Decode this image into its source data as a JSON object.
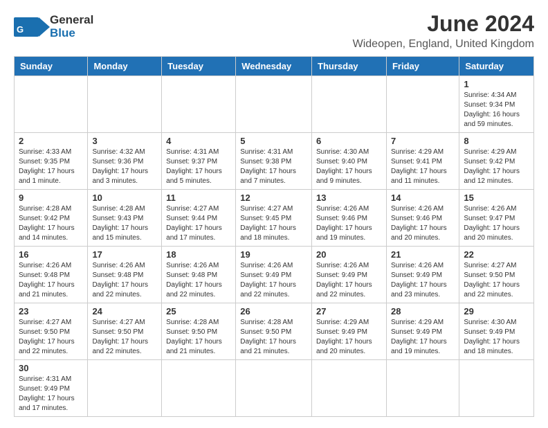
{
  "header": {
    "logo_general": "General",
    "logo_blue": "Blue",
    "month_title": "June 2024",
    "location": "Wideopen, England, United Kingdom"
  },
  "calendar": {
    "days_of_week": [
      "Sunday",
      "Monday",
      "Tuesday",
      "Wednesday",
      "Thursday",
      "Friday",
      "Saturday"
    ],
    "weeks": [
      [
        {
          "day": "",
          "info": ""
        },
        {
          "day": "",
          "info": ""
        },
        {
          "day": "",
          "info": ""
        },
        {
          "day": "",
          "info": ""
        },
        {
          "day": "",
          "info": ""
        },
        {
          "day": "",
          "info": ""
        },
        {
          "day": "1",
          "info": "Sunrise: 4:34 AM\nSunset: 9:34 PM\nDaylight: 16 hours and 59 minutes."
        }
      ],
      [
        {
          "day": "2",
          "info": "Sunrise: 4:33 AM\nSunset: 9:35 PM\nDaylight: 17 hours and 1 minute."
        },
        {
          "day": "3",
          "info": "Sunrise: 4:32 AM\nSunset: 9:36 PM\nDaylight: 17 hours and 3 minutes."
        },
        {
          "day": "4",
          "info": "Sunrise: 4:31 AM\nSunset: 9:37 PM\nDaylight: 17 hours and 5 minutes."
        },
        {
          "day": "5",
          "info": "Sunrise: 4:31 AM\nSunset: 9:38 PM\nDaylight: 17 hours and 7 minutes."
        },
        {
          "day": "6",
          "info": "Sunrise: 4:30 AM\nSunset: 9:40 PM\nDaylight: 17 hours and 9 minutes."
        },
        {
          "day": "7",
          "info": "Sunrise: 4:29 AM\nSunset: 9:41 PM\nDaylight: 17 hours and 11 minutes."
        },
        {
          "day": "8",
          "info": "Sunrise: 4:29 AM\nSunset: 9:42 PM\nDaylight: 17 hours and 12 minutes."
        }
      ],
      [
        {
          "day": "9",
          "info": "Sunrise: 4:28 AM\nSunset: 9:42 PM\nDaylight: 17 hours and 14 minutes."
        },
        {
          "day": "10",
          "info": "Sunrise: 4:28 AM\nSunset: 9:43 PM\nDaylight: 17 hours and 15 minutes."
        },
        {
          "day": "11",
          "info": "Sunrise: 4:27 AM\nSunset: 9:44 PM\nDaylight: 17 hours and 17 minutes."
        },
        {
          "day": "12",
          "info": "Sunrise: 4:27 AM\nSunset: 9:45 PM\nDaylight: 17 hours and 18 minutes."
        },
        {
          "day": "13",
          "info": "Sunrise: 4:26 AM\nSunset: 9:46 PM\nDaylight: 17 hours and 19 minutes."
        },
        {
          "day": "14",
          "info": "Sunrise: 4:26 AM\nSunset: 9:46 PM\nDaylight: 17 hours and 20 minutes."
        },
        {
          "day": "15",
          "info": "Sunrise: 4:26 AM\nSunset: 9:47 PM\nDaylight: 17 hours and 20 minutes."
        }
      ],
      [
        {
          "day": "16",
          "info": "Sunrise: 4:26 AM\nSunset: 9:48 PM\nDaylight: 17 hours and 21 minutes."
        },
        {
          "day": "17",
          "info": "Sunrise: 4:26 AM\nSunset: 9:48 PM\nDaylight: 17 hours and 22 minutes."
        },
        {
          "day": "18",
          "info": "Sunrise: 4:26 AM\nSunset: 9:48 PM\nDaylight: 17 hours and 22 minutes."
        },
        {
          "day": "19",
          "info": "Sunrise: 4:26 AM\nSunset: 9:49 PM\nDaylight: 17 hours and 22 minutes."
        },
        {
          "day": "20",
          "info": "Sunrise: 4:26 AM\nSunset: 9:49 PM\nDaylight: 17 hours and 22 minutes."
        },
        {
          "day": "21",
          "info": "Sunrise: 4:26 AM\nSunset: 9:49 PM\nDaylight: 17 hours and 23 minutes."
        },
        {
          "day": "22",
          "info": "Sunrise: 4:27 AM\nSunset: 9:50 PM\nDaylight: 17 hours and 22 minutes."
        }
      ],
      [
        {
          "day": "23",
          "info": "Sunrise: 4:27 AM\nSunset: 9:50 PM\nDaylight: 17 hours and 22 minutes."
        },
        {
          "day": "24",
          "info": "Sunrise: 4:27 AM\nSunset: 9:50 PM\nDaylight: 17 hours and 22 minutes."
        },
        {
          "day": "25",
          "info": "Sunrise: 4:28 AM\nSunset: 9:50 PM\nDaylight: 17 hours and 21 minutes."
        },
        {
          "day": "26",
          "info": "Sunrise: 4:28 AM\nSunset: 9:50 PM\nDaylight: 17 hours and 21 minutes."
        },
        {
          "day": "27",
          "info": "Sunrise: 4:29 AM\nSunset: 9:49 PM\nDaylight: 17 hours and 20 minutes."
        },
        {
          "day": "28",
          "info": "Sunrise: 4:29 AM\nSunset: 9:49 PM\nDaylight: 17 hours and 19 minutes."
        },
        {
          "day": "29",
          "info": "Sunrise: 4:30 AM\nSunset: 9:49 PM\nDaylight: 17 hours and 18 minutes."
        }
      ],
      [
        {
          "day": "30",
          "info": "Sunrise: 4:31 AM\nSunset: 9:49 PM\nDaylight: 17 hours and 17 minutes."
        },
        {
          "day": "",
          "info": ""
        },
        {
          "day": "",
          "info": ""
        },
        {
          "day": "",
          "info": ""
        },
        {
          "day": "",
          "info": ""
        },
        {
          "day": "",
          "info": ""
        },
        {
          "day": "",
          "info": ""
        }
      ]
    ]
  }
}
